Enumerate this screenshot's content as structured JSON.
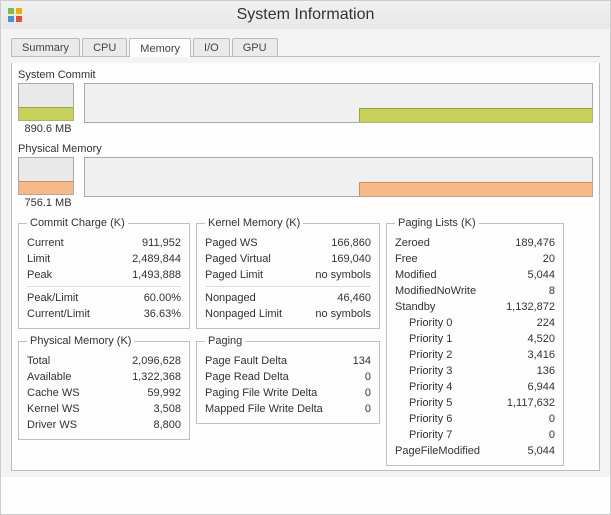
{
  "window": {
    "title": "System Information"
  },
  "tabs": [
    {
      "label": "Summary"
    },
    {
      "label": "CPU"
    },
    {
      "label": "Memory"
    },
    {
      "label": "I/O"
    },
    {
      "label": "GPU"
    }
  ],
  "charts": {
    "commit": {
      "label": "System Commit",
      "value_caption": "890.6 MB",
      "fill_pct": 36.63,
      "color": "#c8d25a",
      "border": "#9aa820"
    },
    "physical": {
      "label": "Physical Memory",
      "value_caption": "756.1 MB",
      "fill_pct": 36.95,
      "color": "#f5b98a",
      "border": "#e68a3f"
    }
  },
  "commit_charge": {
    "legend": "Commit Charge (K)",
    "current_label": "Current",
    "current": "911,952",
    "limit_label": "Limit",
    "limit": "2,489,844",
    "peak_label": "Peak",
    "peak": "1,493,888",
    "peaklimit_label": "Peak/Limit",
    "peaklimit": "60.00%",
    "curlimit_label": "Current/Limit",
    "curlimit": "36.63%"
  },
  "phys_mem": {
    "legend": "Physical Memory (K)",
    "total_label": "Total",
    "total": "2,096,628",
    "avail_label": "Available",
    "avail": "1,322,368",
    "cache_label": "Cache WS",
    "cache": "59,992",
    "kernel_label": "Kernel WS",
    "kernel": "3,508",
    "driver_label": "Driver WS",
    "driver": "8,800"
  },
  "kernel_mem": {
    "legend": "Kernel Memory (K)",
    "pws_label": "Paged WS",
    "pws": "166,860",
    "pv_label": "Paged Virtual",
    "pv": "169,040",
    "pl_label": "Paged Limit",
    "pl": "no symbols",
    "np_label": "Nonpaged",
    "np": "46,460",
    "npl_label": "Nonpaged Limit",
    "npl": "no symbols"
  },
  "paging": {
    "legend": "Paging",
    "pfd_label": "Page Fault Delta",
    "pfd": "134",
    "prd_label": "Page Read Delta",
    "prd": "0",
    "pwd_label": "Paging File Write Delta",
    "pwd": "0",
    "mwd_label": "Mapped File Write Delta",
    "mwd": "0"
  },
  "paging_lists": {
    "legend": "Paging Lists (K)",
    "zero_label": "Zeroed",
    "zero": "189,476",
    "free_label": "Free",
    "free": "20",
    "mod_label": "Modified",
    "mod": "5,044",
    "mnw_label": "ModifiedNoWrite",
    "mnw": "8",
    "standby_label": "Standby",
    "standby": "1,132,872",
    "p0_label": "Priority 0",
    "p0": "224",
    "p1_label": "Priority 1",
    "p1": "4,520",
    "p2_label": "Priority 2",
    "p2": "3,416",
    "p3_label": "Priority 3",
    "p3": "136",
    "p4_label": "Priority 4",
    "p4": "6,944",
    "p5_label": "Priority 5",
    "p5": "1,117,632",
    "p6_label": "Priority 6",
    "p6": "0",
    "p7_label": "Priority 7",
    "p7": "0",
    "pfm_label": "PageFileModified",
    "pfm": "5,044"
  }
}
